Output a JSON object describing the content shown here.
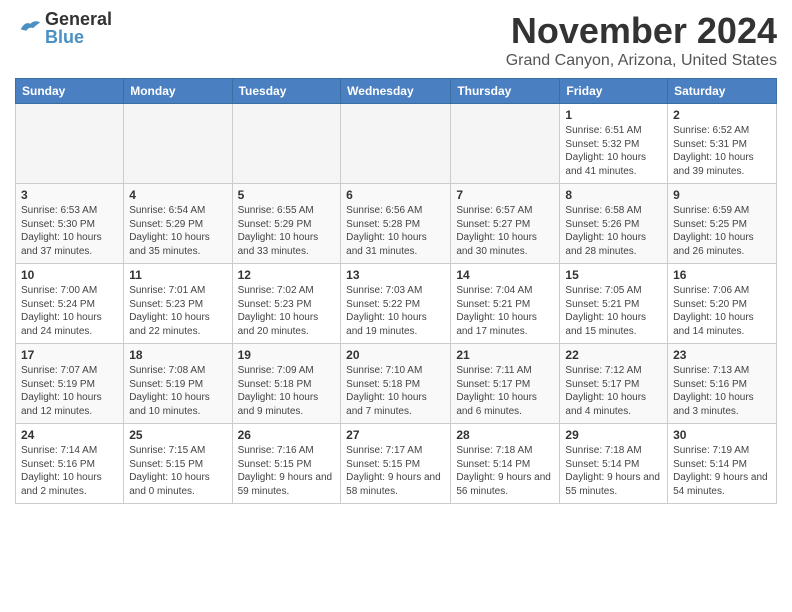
{
  "header": {
    "logo_general": "General",
    "logo_blue": "Blue",
    "month_title": "November 2024",
    "location": "Grand Canyon, Arizona, United States"
  },
  "calendar": {
    "headers": [
      "Sunday",
      "Monday",
      "Tuesday",
      "Wednesday",
      "Thursday",
      "Friday",
      "Saturday"
    ],
    "rows": [
      [
        {
          "day": "",
          "empty": true
        },
        {
          "day": "",
          "empty": true
        },
        {
          "day": "",
          "empty": true
        },
        {
          "day": "",
          "empty": true
        },
        {
          "day": "",
          "empty": true
        },
        {
          "day": "1",
          "sunrise": "6:51 AM",
          "sunset": "5:32 PM",
          "daylight": "10 hours and 41 minutes."
        },
        {
          "day": "2",
          "sunrise": "6:52 AM",
          "sunset": "5:31 PM",
          "daylight": "10 hours and 39 minutes."
        }
      ],
      [
        {
          "day": "3",
          "sunrise": "6:53 AM",
          "sunset": "5:30 PM",
          "daylight": "10 hours and 37 minutes."
        },
        {
          "day": "4",
          "sunrise": "6:54 AM",
          "sunset": "5:29 PM",
          "daylight": "10 hours and 35 minutes."
        },
        {
          "day": "5",
          "sunrise": "6:55 AM",
          "sunset": "5:29 PM",
          "daylight": "10 hours and 33 minutes."
        },
        {
          "day": "6",
          "sunrise": "6:56 AM",
          "sunset": "5:28 PM",
          "daylight": "10 hours and 31 minutes."
        },
        {
          "day": "7",
          "sunrise": "6:57 AM",
          "sunset": "5:27 PM",
          "daylight": "10 hours and 30 minutes."
        },
        {
          "day": "8",
          "sunrise": "6:58 AM",
          "sunset": "5:26 PM",
          "daylight": "10 hours and 28 minutes."
        },
        {
          "day": "9",
          "sunrise": "6:59 AM",
          "sunset": "5:25 PM",
          "daylight": "10 hours and 26 minutes."
        }
      ],
      [
        {
          "day": "10",
          "sunrise": "7:00 AM",
          "sunset": "5:24 PM",
          "daylight": "10 hours and 24 minutes."
        },
        {
          "day": "11",
          "sunrise": "7:01 AM",
          "sunset": "5:23 PM",
          "daylight": "10 hours and 22 minutes."
        },
        {
          "day": "12",
          "sunrise": "7:02 AM",
          "sunset": "5:23 PM",
          "daylight": "10 hours and 20 minutes."
        },
        {
          "day": "13",
          "sunrise": "7:03 AM",
          "sunset": "5:22 PM",
          "daylight": "10 hours and 19 minutes."
        },
        {
          "day": "14",
          "sunrise": "7:04 AM",
          "sunset": "5:21 PM",
          "daylight": "10 hours and 17 minutes."
        },
        {
          "day": "15",
          "sunrise": "7:05 AM",
          "sunset": "5:21 PM",
          "daylight": "10 hours and 15 minutes."
        },
        {
          "day": "16",
          "sunrise": "7:06 AM",
          "sunset": "5:20 PM",
          "daylight": "10 hours and 14 minutes."
        }
      ],
      [
        {
          "day": "17",
          "sunrise": "7:07 AM",
          "sunset": "5:19 PM",
          "daylight": "10 hours and 12 minutes."
        },
        {
          "day": "18",
          "sunrise": "7:08 AM",
          "sunset": "5:19 PM",
          "daylight": "10 hours and 10 minutes."
        },
        {
          "day": "19",
          "sunrise": "7:09 AM",
          "sunset": "5:18 PM",
          "daylight": "10 hours and 9 minutes."
        },
        {
          "day": "20",
          "sunrise": "7:10 AM",
          "sunset": "5:18 PM",
          "daylight": "10 hours and 7 minutes."
        },
        {
          "day": "21",
          "sunrise": "7:11 AM",
          "sunset": "5:17 PM",
          "daylight": "10 hours and 6 minutes."
        },
        {
          "day": "22",
          "sunrise": "7:12 AM",
          "sunset": "5:17 PM",
          "daylight": "10 hours and 4 minutes."
        },
        {
          "day": "23",
          "sunrise": "7:13 AM",
          "sunset": "5:16 PM",
          "daylight": "10 hours and 3 minutes."
        }
      ],
      [
        {
          "day": "24",
          "sunrise": "7:14 AM",
          "sunset": "5:16 PM",
          "daylight": "10 hours and 2 minutes."
        },
        {
          "day": "25",
          "sunrise": "7:15 AM",
          "sunset": "5:15 PM",
          "daylight": "10 hours and 0 minutes."
        },
        {
          "day": "26",
          "sunrise": "7:16 AM",
          "sunset": "5:15 PM",
          "daylight": "9 hours and 59 minutes."
        },
        {
          "day": "27",
          "sunrise": "7:17 AM",
          "sunset": "5:15 PM",
          "daylight": "9 hours and 58 minutes."
        },
        {
          "day": "28",
          "sunrise": "7:18 AM",
          "sunset": "5:14 PM",
          "daylight": "9 hours and 56 minutes."
        },
        {
          "day": "29",
          "sunrise": "7:18 AM",
          "sunset": "5:14 PM",
          "daylight": "9 hours and 55 minutes."
        },
        {
          "day": "30",
          "sunrise": "7:19 AM",
          "sunset": "5:14 PM",
          "daylight": "9 hours and 54 minutes."
        }
      ]
    ]
  }
}
